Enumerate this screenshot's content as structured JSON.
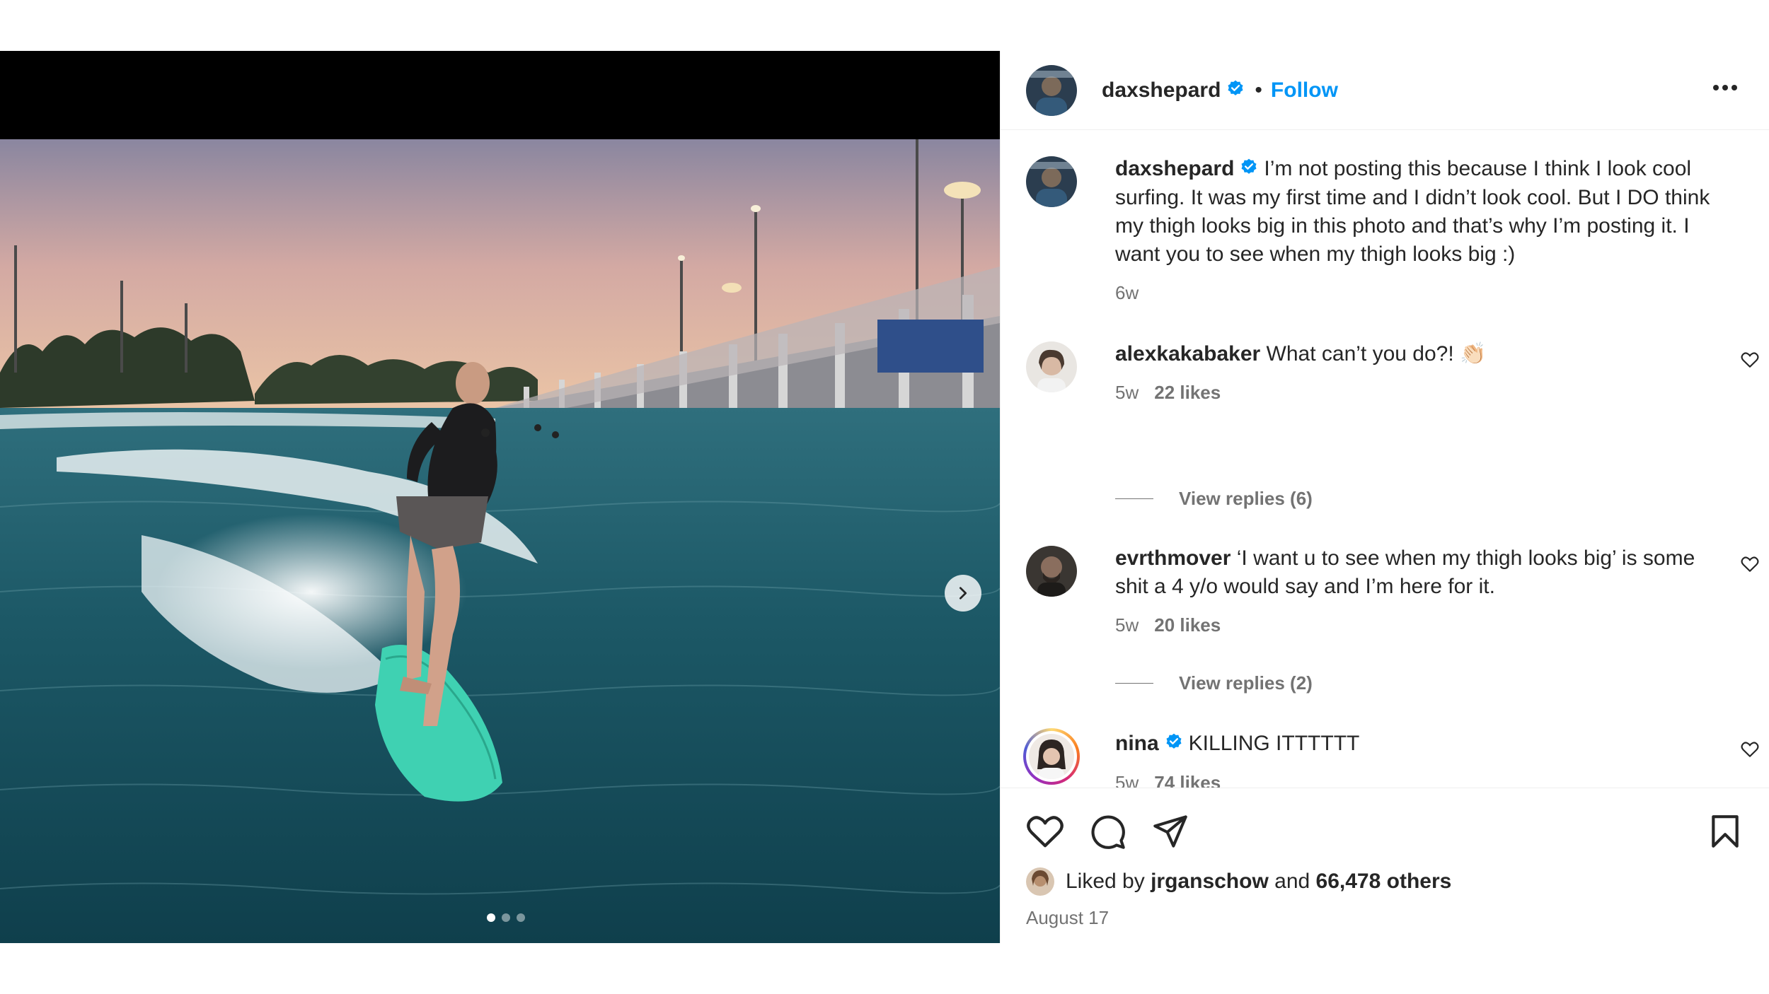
{
  "post": {
    "author": "daxshepard",
    "follow_label": "Follow",
    "separator": "•",
    "caption": "I’m not posting this because I think I look cool surfing. It was my first time and I didn’t look cool. But I DO think my thigh looks big in this photo and that’s why I’m posting it. I want you to see when my thigh looks big :)",
    "caption_age": "6w",
    "liked_by_prefix": "Liked by",
    "liked_by_user": "jrganschow",
    "liked_by_and": "and",
    "liked_by_others": "66,478 others",
    "date": "August 17",
    "carousel": {
      "count": 3,
      "active_index": 0
    }
  },
  "comments": [
    {
      "user": "alexkakabaker",
      "text": "What can’t you do?! 👏🏻",
      "age": "5w",
      "likes": "22 likes",
      "replies": "View replies (6)"
    },
    {
      "user": "evrthmover",
      "text": "‘I want u to see when my thigh looks big’ is some shit a 4 y/o would say and I’m here for it.",
      "age": "5w",
      "likes": "20 likes",
      "replies": "View replies (2)"
    },
    {
      "user": "nina",
      "text": "KILLING ITTTTTT",
      "age": "5w",
      "likes": "74 likes",
      "verified": true
    }
  ],
  "icons": {
    "verified": "verified-badge-icon",
    "more": "more-options-icon",
    "like": "heart-icon",
    "comment": "comment-bubble-icon",
    "share": "paper-plane-icon",
    "save": "bookmark-icon",
    "next": "chevron-right-icon"
  },
  "colors": {
    "accent": "#0095f6",
    "text": "#262626",
    "muted": "#737373",
    "divider": "#efefef"
  }
}
